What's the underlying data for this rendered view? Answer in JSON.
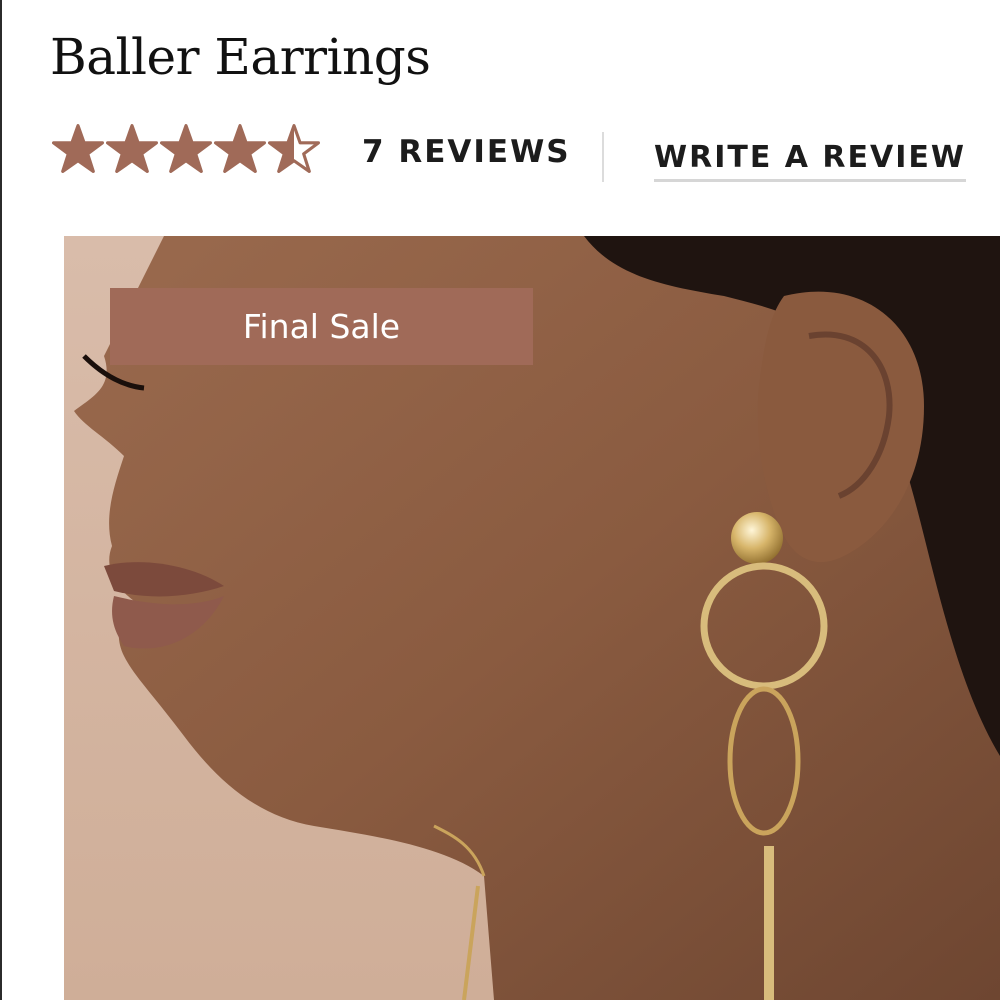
{
  "product": {
    "title": "Baller Earrings"
  },
  "rating": {
    "value": 4.5,
    "max": 5,
    "star_color": "#a06a58",
    "reviews_label": "7 REVIEWS",
    "write_review_label": "WRITE A REVIEW"
  },
  "image": {
    "badge_label": "Final Sale",
    "badge_color": "#a06a58",
    "background_color": "#d4b5a1"
  }
}
